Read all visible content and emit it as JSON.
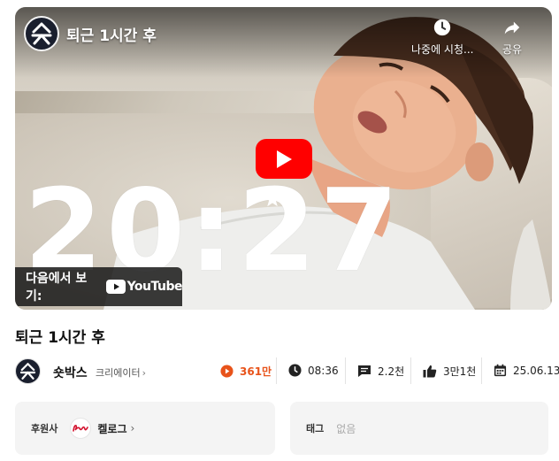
{
  "video": {
    "title": "퇴근 1시간 후",
    "watch_later_label": "나중에 시청...",
    "share_label": "공유",
    "overlay_time": "20:27",
    "watch_on_label": "다음에서 보기:",
    "youtube_wordmark": "YouTube",
    "play_color": "#ff0000"
  },
  "page": {
    "title": "퇴근 1시간 후"
  },
  "creator": {
    "name": "숏박스",
    "role_label": "크리에이터",
    "chevron": "›"
  },
  "stats": {
    "views": "361만",
    "length": "08:36",
    "comments": "2.2천",
    "likes": "3만1천",
    "date": "25.06.13",
    "views_color": "#e8531a"
  },
  "sponsor": {
    "key_label": "후원사",
    "name": "켈로그",
    "chevron": "›"
  },
  "tags": {
    "key_label": "태그",
    "value": "없음"
  }
}
